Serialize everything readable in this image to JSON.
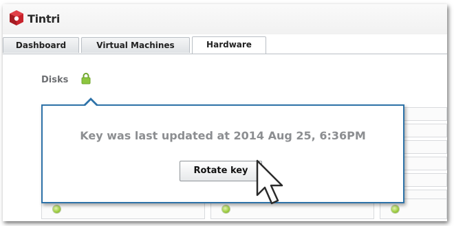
{
  "app": {
    "name": "Tintri"
  },
  "tabs": [
    {
      "label": "Dashboard"
    },
    {
      "label": "Virtual Machines"
    },
    {
      "label": "Hardware"
    }
  ],
  "active_tab": "Hardware",
  "section": {
    "title": "Disks",
    "icon": "lock-icon"
  },
  "popover": {
    "message": "Key was last updated at 2014 Aug 25, 6:36PM",
    "button_label": "Rotate key"
  },
  "colors": {
    "popover_border": "#2d72a8",
    "status_led": "#9ccc3f",
    "lock_icon": "#8dc63f"
  }
}
